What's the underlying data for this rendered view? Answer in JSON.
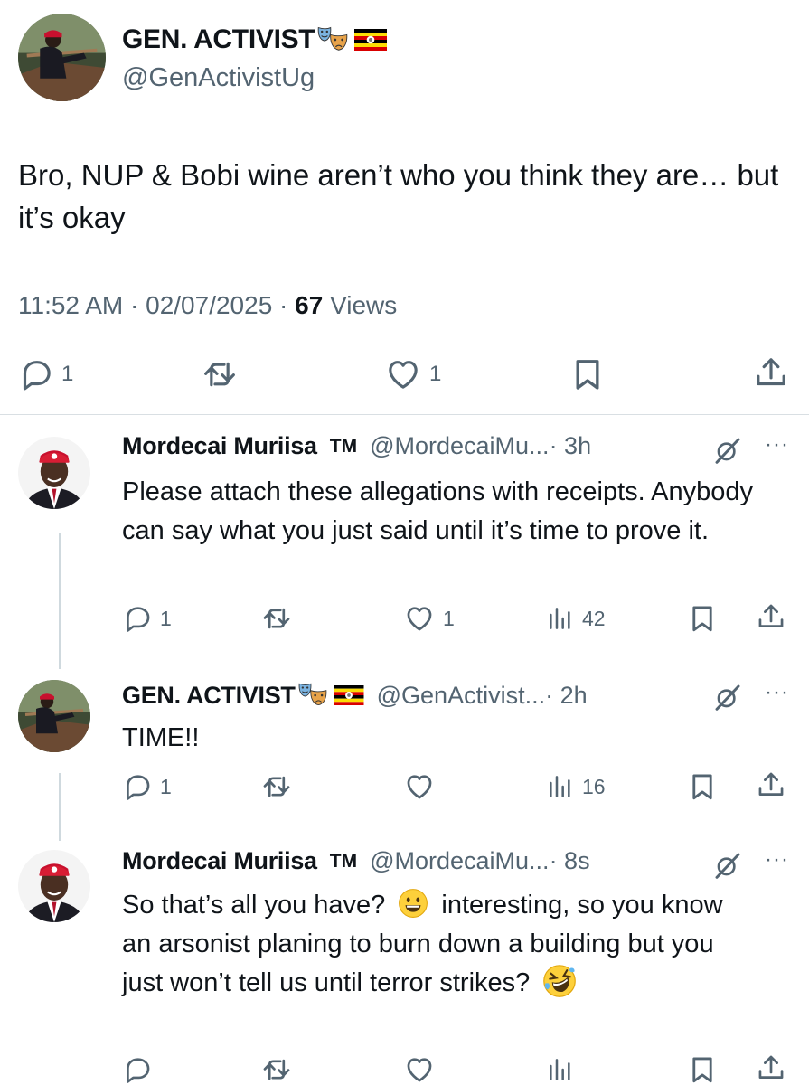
{
  "main_tweet": {
    "author_name": "GEN. ACTIVIST",
    "handle": "@GenActivistUg",
    "text": "Bro, NUP & Bobi wine aren’t who you think they are… but it’s okay",
    "time": "11:52 AM",
    "date": "02/07/2025",
    "views_count": "67",
    "views_label": "Views",
    "separator": "·",
    "reply_count": "1",
    "like_count": "1",
    "icons": [
      "reply-icon",
      "retweet-icon",
      "like-icon",
      "bookmark-icon",
      "share-icon"
    ]
  },
  "replies": [
    {
      "author_name": "Mordecai Muriisa",
      "trademark": "TM",
      "handle": "@MordecaiMu...",
      "time": "· 3h",
      "text": "Please attach these allegations with receipts. Anybody can say what you just said until it’s time to prove it.",
      "reply_count": "1",
      "retweet_count": "",
      "like_count": "1",
      "view_count": "42"
    },
    {
      "author_name": "GEN. ACTIVIST",
      "handle": "@GenActivist...",
      "time": "· 2h",
      "text": "TIME!!",
      "reply_count": "1",
      "retweet_count": "",
      "like_count": "",
      "view_count": "16"
    },
    {
      "author_name": "Mordecai Muriisa",
      "trademark": "TM",
      "handle": "@MordecaiMu...",
      "time": "· 8s",
      "text_part1": "So that’s all you have?",
      "text_part2": "interesting, so you know an arsonist planing to burn down a building but you just won’t tell us until terror strikes?",
      "reply_count": "",
      "retweet_count": "",
      "like_count": "",
      "view_count": ""
    }
  ],
  "more_label": "···",
  "colors": {
    "text": "#0f1419",
    "secondary": "#536471",
    "divider": "#d9dfe3",
    "thread_line": "#cfd9de",
    "uganda_black": "#000000",
    "uganda_yellow": "#fcdc04",
    "uganda_red": "#d90000"
  }
}
